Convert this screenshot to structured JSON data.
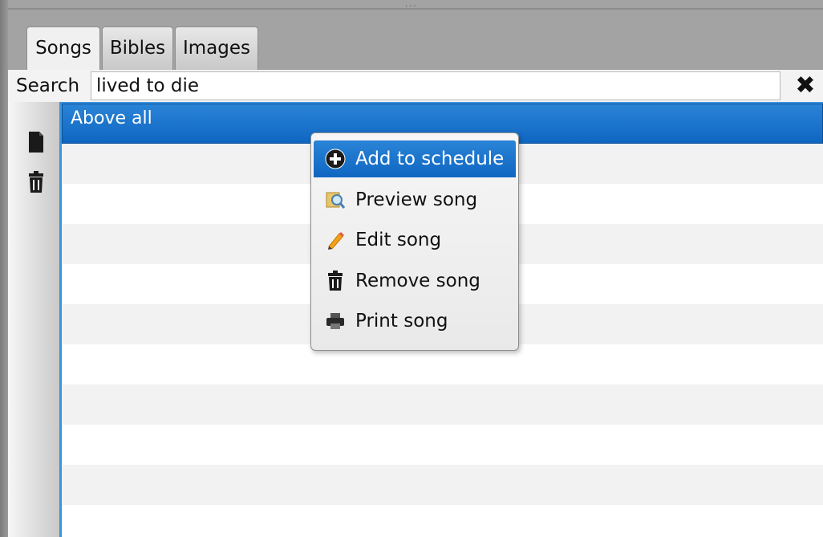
{
  "tabs": [
    {
      "label": "Songs",
      "active": true
    },
    {
      "label": "Bibles",
      "active": false
    },
    {
      "label": "Images",
      "active": false
    }
  ],
  "search": {
    "label": "Search",
    "value": "lived to die",
    "clear_icon": "close-icon"
  },
  "toolbar": {
    "icons": [
      "new-document-icon",
      "trash-icon"
    ]
  },
  "song_list": {
    "items": [
      "Above all"
    ],
    "selected_index": 0
  },
  "context_menu": {
    "items": [
      {
        "label": "Add to schedule",
        "icon": "add-circle-icon",
        "highlighted": true
      },
      {
        "label": "Preview song",
        "icon": "preview-icon",
        "highlighted": false
      },
      {
        "label": "Edit song",
        "icon": "pencil-icon",
        "highlighted": false
      },
      {
        "label": "Remove song",
        "icon": "trash-icon",
        "highlighted": false
      },
      {
        "label": "Print song",
        "icon": "printer-icon",
        "highlighted": false
      }
    ]
  },
  "colors": {
    "accent": "#1670c8",
    "panel": "#a3a3a3"
  }
}
